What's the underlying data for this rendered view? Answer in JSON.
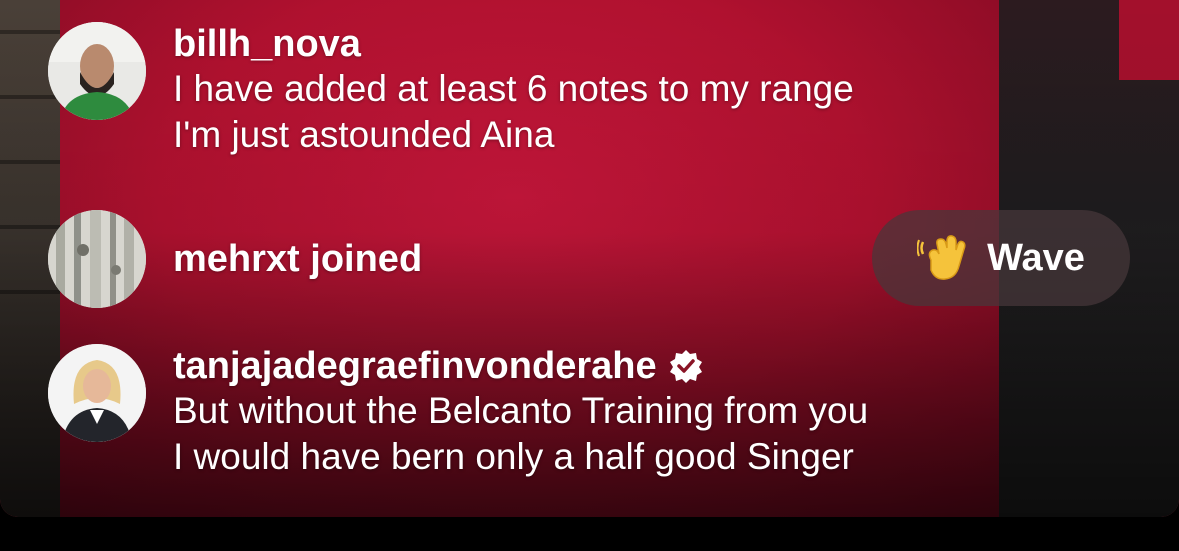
{
  "comments": [
    {
      "username": "billh_nova",
      "message_lines": [
        "I have added at least 6 notes to my range",
        "I'm just astounded Aina"
      ]
    },
    {
      "username": "mehrxt joined",
      "message_lines": []
    },
    {
      "username": "tanjajadegraefinvonderahe",
      "verified": true,
      "message_lines": [
        "But without the Belcanto Training from you",
        "I would have bern only a half good Singer"
      ]
    }
  ],
  "wave_button": {
    "label": "Wave",
    "icon": "waving-hand-icon"
  },
  "colors": {
    "background_red": "#b0102e",
    "wave_button_bg": "#46373a",
    "text": "#ffffff"
  }
}
